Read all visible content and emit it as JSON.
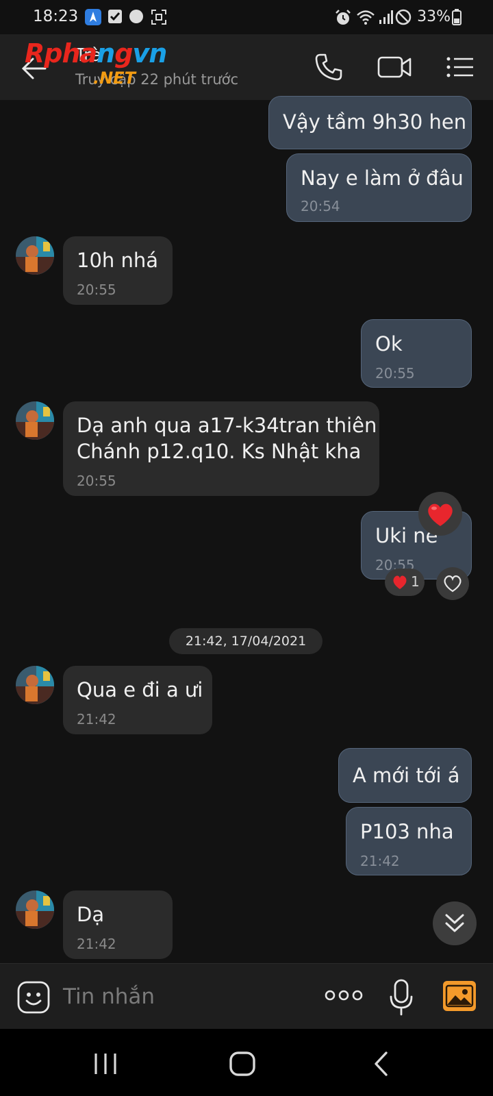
{
  "status_bar": {
    "time": "18:23",
    "battery": "33%"
  },
  "header": {
    "contact_name": "Trà",
    "last_seen": "Truy cập 22 phút trước",
    "watermark_logo": {
      "main": "Rphangvn",
      "sub": ".NET"
    }
  },
  "messages": [
    {
      "dir": "out",
      "text": "Vậy tầm 9h30 hen",
      "time": ""
    },
    {
      "dir": "out",
      "text": "Nay e làm ở đâu",
      "time": "20:54"
    },
    {
      "dir": "in",
      "text": "10h nhá",
      "time": "20:55"
    },
    {
      "dir": "out",
      "text": "Ok",
      "time": "20:55"
    },
    {
      "dir": "in",
      "text_line1": "Dạ anh qua a17-k34tran thiên",
      "text_line2": "Chánh p12.q10. Ks Nhật kha",
      "time": "20:55"
    },
    {
      "dir": "out",
      "text": "Uki nè",
      "time": "20:55",
      "reaction_count": "1"
    },
    {
      "dir": "in",
      "text": "Qua e đi a ưi",
      "time": "21:42"
    },
    {
      "dir": "out",
      "text": "A mới tới á",
      "time": ""
    },
    {
      "dir": "out",
      "text": "P103 nha",
      "time": "21:42"
    },
    {
      "dir": "in",
      "text": "Dạ",
      "time": "21:42"
    }
  ],
  "date_separator": "21:42, 17/04/2021",
  "composer": {
    "placeholder": "Tin nhắn"
  },
  "colors": {
    "outgoing_bubble": "#3b4654",
    "incoming_bubble": "#2b2b2b",
    "background": "#121212",
    "heart": "#e8262d"
  }
}
